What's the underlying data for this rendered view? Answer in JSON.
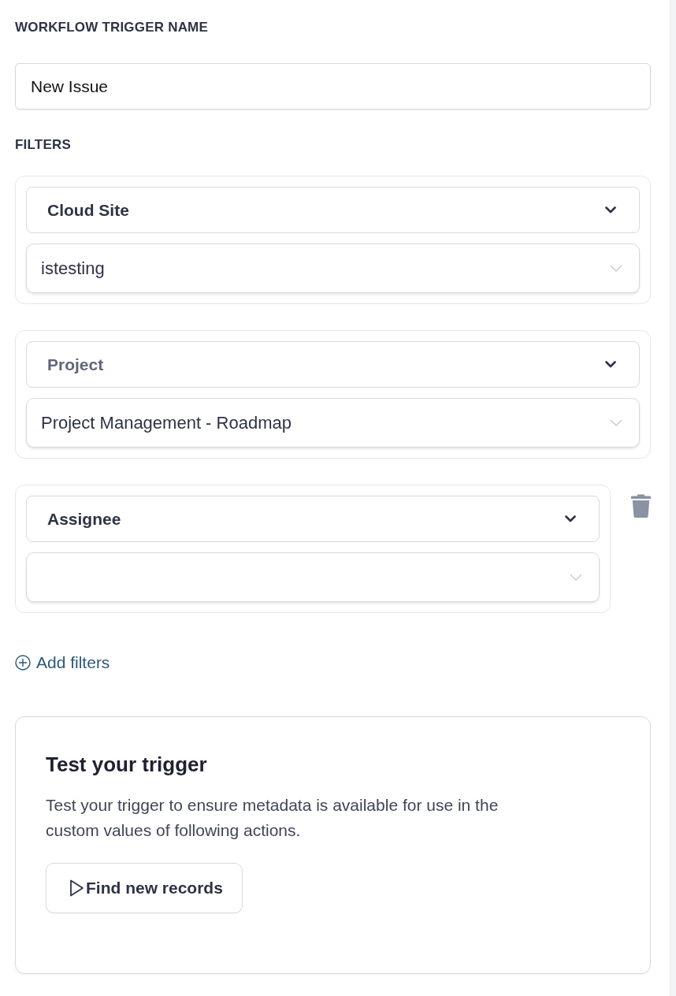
{
  "trigger_name": {
    "label": "WORKFLOW TRIGGER NAME",
    "value": "New Issue"
  },
  "filters": {
    "label": "FILTERS",
    "items": [
      {
        "field": "Cloud Site",
        "field_disabled": false,
        "value": "istesting",
        "deletable": false
      },
      {
        "field": "Project",
        "field_disabled": true,
        "value": "Project Management - Roadmap",
        "deletable": false
      },
      {
        "field": "Assignee",
        "field_disabled": false,
        "deletable": true
      }
    ]
  },
  "add_filters": {
    "label": "Add filters"
  },
  "test_card": {
    "title": "Test your trigger",
    "description": "Test your trigger to ensure metadata is available for use in the custom values of following actions.",
    "button": "Find new records"
  }
}
